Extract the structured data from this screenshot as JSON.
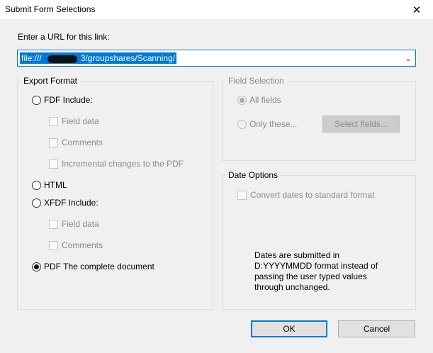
{
  "window": {
    "title": "Submit Form Selections"
  },
  "url": {
    "label": "Enter a URL for this link:",
    "prefix": "file:///",
    "suffix": "3/groupshares/Scanning/"
  },
  "export_format": {
    "title": "Export Format",
    "fdf": {
      "label": "FDF  Include:",
      "options": [
        "Field data",
        "Comments",
        "Incremental changes to the PDF"
      ]
    },
    "html": {
      "label": "HTML"
    },
    "xfdf": {
      "label": "XFDF  Include:",
      "options": [
        "Field data",
        "Comments"
      ]
    },
    "pdf": {
      "label": "PDF  The complete document",
      "selected": true
    }
  },
  "field_selection": {
    "title": "Field Selection",
    "all_fields": "All fields",
    "only_these": "Only these...",
    "select_fields_button": "Select fields..."
  },
  "date_options": {
    "title": "Date Options",
    "convert_label": "Convert dates to standard format",
    "note_lines": [
      "Dates are submitted in",
      "D:YYYYMMDD format instead of",
      "passing the user typed values",
      "through unchanged."
    ]
  },
  "buttons": {
    "ok": "OK",
    "cancel": "Cancel"
  },
  "colors": {
    "accent": "#0078d7",
    "background": "#f0f0f0",
    "disabled_text": "#8b8b8b"
  }
}
